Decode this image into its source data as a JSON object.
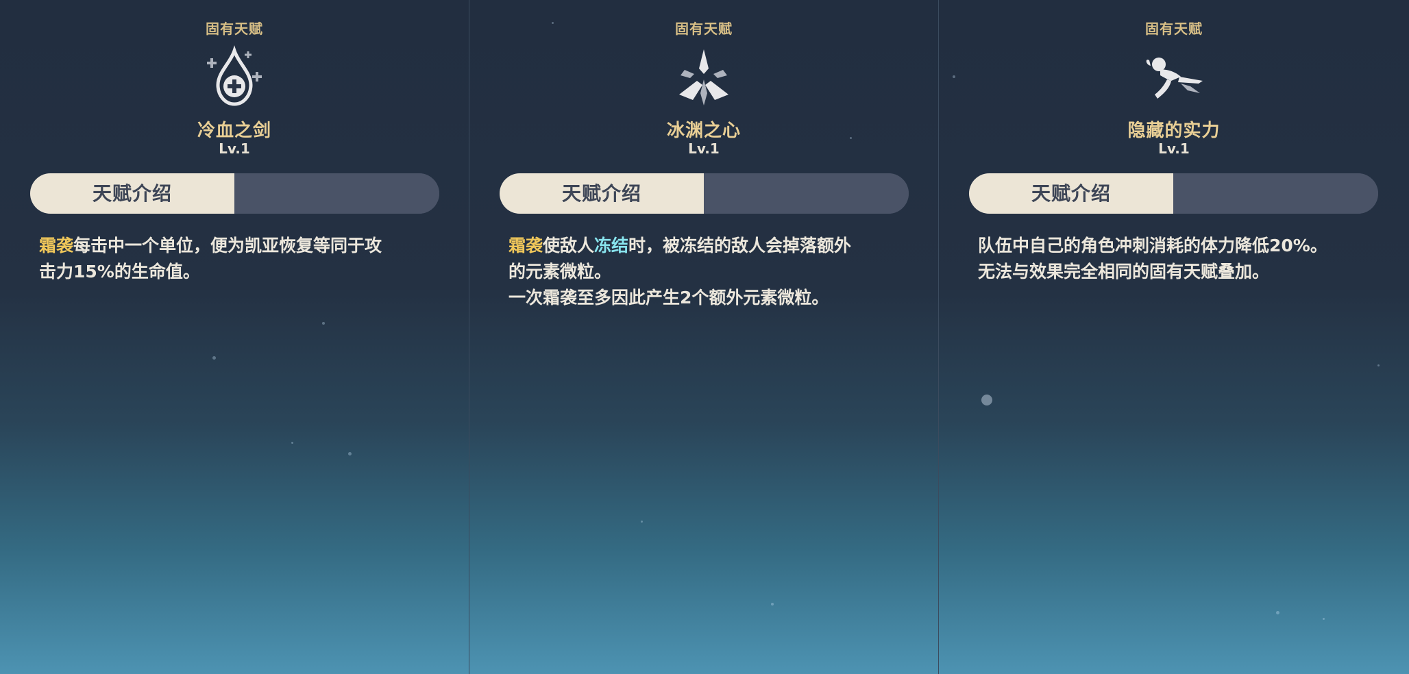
{
  "panels": [
    {
      "category": "固有天赋",
      "icon": "healing-droplet-icon",
      "name": "冷血之剑",
      "level": "Lv.1",
      "tabs": {
        "active": "天赋介绍",
        "inactive": ""
      },
      "description": {
        "line1": {
          "keyword": "霜袭",
          "text": "每击中一个单位，便为凯亚恢复等同于攻"
        },
        "line2": "击力15%的生命值。"
      }
    },
    {
      "category": "固有天赋",
      "icon": "ice-crystal-icon",
      "name": "冰渊之心",
      "level": "Lv.1",
      "tabs": {
        "active": "天赋介绍",
        "inactive": ""
      },
      "description": {
        "line1": {
          "keyword": "霜袭",
          "text_a": "使敌人",
          "keyword2": "冻结",
          "text_b": "时，被冻结的敌人会掉落额外"
        },
        "line2": "的元素微粒。",
        "line3": "一次霜袭至多因此产生2个额外元素微粒。"
      }
    },
    {
      "category": "固有天赋",
      "icon": "running-figure-icon",
      "name": "隐藏的实力",
      "level": "Lv.1",
      "tabs": {
        "active": "天赋介绍",
        "inactive": ""
      },
      "description": {
        "line1": "队伍中自己的角色冲刺消耗的体力降低20%。",
        "line2": "无法与效果完全相同的固有天赋叠加。"
      }
    }
  ],
  "colors": {
    "gold_keyword": "#f0c75a",
    "cyan_keyword": "#88e4ee",
    "title_gold": "#e9cf95",
    "tab_active_bg": "#ece5d6",
    "tab_inactive_bg": "#4a5367"
  }
}
